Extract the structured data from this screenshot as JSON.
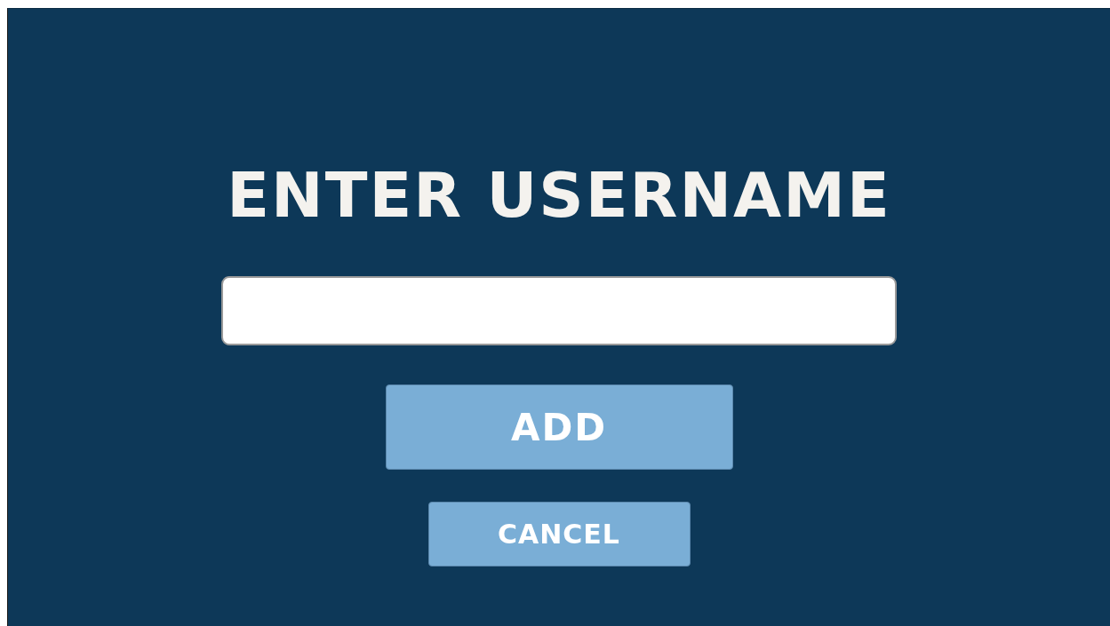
{
  "title": "ENTER USERNAME",
  "buttons": [
    {
      "label": "ADD",
      "kind": "large"
    },
    {
      "label": "CANCEL",
      "kind": "small"
    }
  ]
}
